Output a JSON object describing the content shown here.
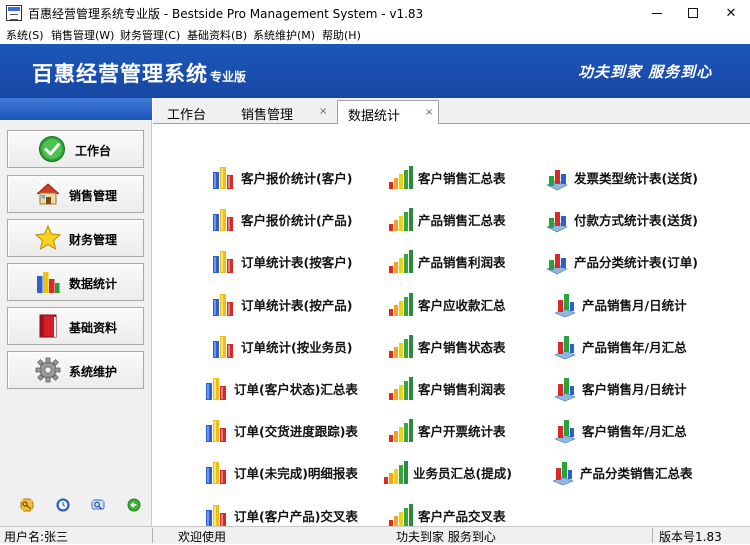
{
  "window": {
    "title": "百惠经营管理系统专业版 - Bestside Pro Management System - v1.83",
    "minimize_glyph": "",
    "close_glyph": "✕"
  },
  "menu": [
    "系统(S)",
    "销售管理(W)",
    "财务管理(C)",
    "基础资料(B)",
    "系统维护(M)",
    "帮助(H)"
  ],
  "banner": {
    "title": "百惠经营管理系统",
    "title_suffix": "专业版",
    "slogan": "功夫到家 服务到心",
    "colors": {
      "top": "#1d58b8",
      "bottom": "#1646a2"
    }
  },
  "sidebar": {
    "items": [
      {
        "label": "工作台",
        "icon": "check-circle-icon"
      },
      {
        "label": "销售管理",
        "icon": "house-icon"
      },
      {
        "label": "财务管理",
        "icon": "star-icon"
      },
      {
        "label": "数据统计",
        "icon": "bar-chart-icon"
      },
      {
        "label": "基础资料",
        "icon": "red-book-icon"
      },
      {
        "label": "系统维护",
        "icon": "gear-icon"
      }
    ],
    "bottom_icons": [
      "key-icon",
      "clock-icon",
      "search-window-icon",
      "back-arrow-icon"
    ]
  },
  "tabs": [
    {
      "label": "工作台",
      "closable": false
    },
    {
      "label": "销售管理",
      "closable": true,
      "close_glyph": "×"
    },
    {
      "label": "数据统计",
      "closable": true,
      "close_glyph": "×",
      "active": true
    }
  ],
  "reports": {
    "col1": [
      "客户报价统计(客户)",
      "客户报价统计(产品)",
      "订单统计表(按客户)",
      "订单统计表(按产品)",
      "订单统计(按业务员)",
      "订单(客户状态)汇总表",
      "订单(交货进度跟踪)表",
      "订单(未完成)明细报表",
      "订单(客户产品)交叉表"
    ],
    "col2": [
      "客户销售汇总表",
      "产品销售汇总表",
      "产品销售利润表",
      "客户应收款汇总",
      "客户销售状态表",
      "客户销售利润表",
      "客户开票统计表",
      "业务员汇总(提成)",
      "客户产品交叉表"
    ],
    "col3": [
      "发票类型统计表(送货)",
      "付款方式统计表(送货)",
      "产品分类统计表(订单)",
      "产品销售月/日统计",
      "产品销售年/月汇总",
      "客户销售月/日统计",
      "客户销售年/月汇总",
      "产品分类销售汇总表"
    ]
  },
  "statusbar": {
    "user": "用户名:张三",
    "welcome": "欢迎使用",
    "slogan": "功夫到家 服务到心",
    "version": "版本号1.83"
  }
}
